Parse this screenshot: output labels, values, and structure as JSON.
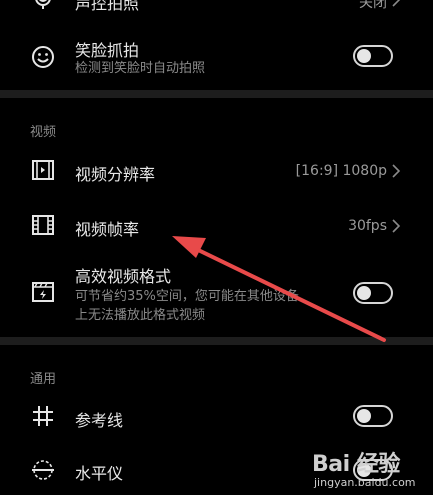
{
  "rows": {
    "top_partial": {
      "title": "声控拍照",
      "value": "关闭"
    },
    "smile": {
      "title": "笑脸抓拍",
      "subtitle": "检测到笑脸时自动拍照",
      "enabled": false
    },
    "resolution": {
      "title": "视频分辨率",
      "value": "[16:9] 1080p"
    },
    "framerate": {
      "title": "视频帧率",
      "value": "30fps"
    },
    "efficient": {
      "title": "高效视频格式",
      "subtitle_line1": "可节省约35%空间，您可能在其他设备",
      "subtitle_line2": "上无法播放此格式视频",
      "enabled": false
    },
    "grid": {
      "title": "参考线",
      "enabled": false
    },
    "level": {
      "title": "水平仪",
      "enabled": false
    }
  },
  "sections": {
    "video": "视频",
    "general": "通用"
  },
  "icons": [
    "microphone-icon",
    "smile-icon",
    "video-resolution-icon",
    "film-icon",
    "video-format-icon",
    "grid-icon",
    "level-icon"
  ],
  "watermark": {
    "logo": "Bai 经验",
    "url": "jingyan.baidu.com"
  },
  "colors": {
    "background": "#000000",
    "divider": "#1d1d1d",
    "arrow": "#e84a4a"
  }
}
